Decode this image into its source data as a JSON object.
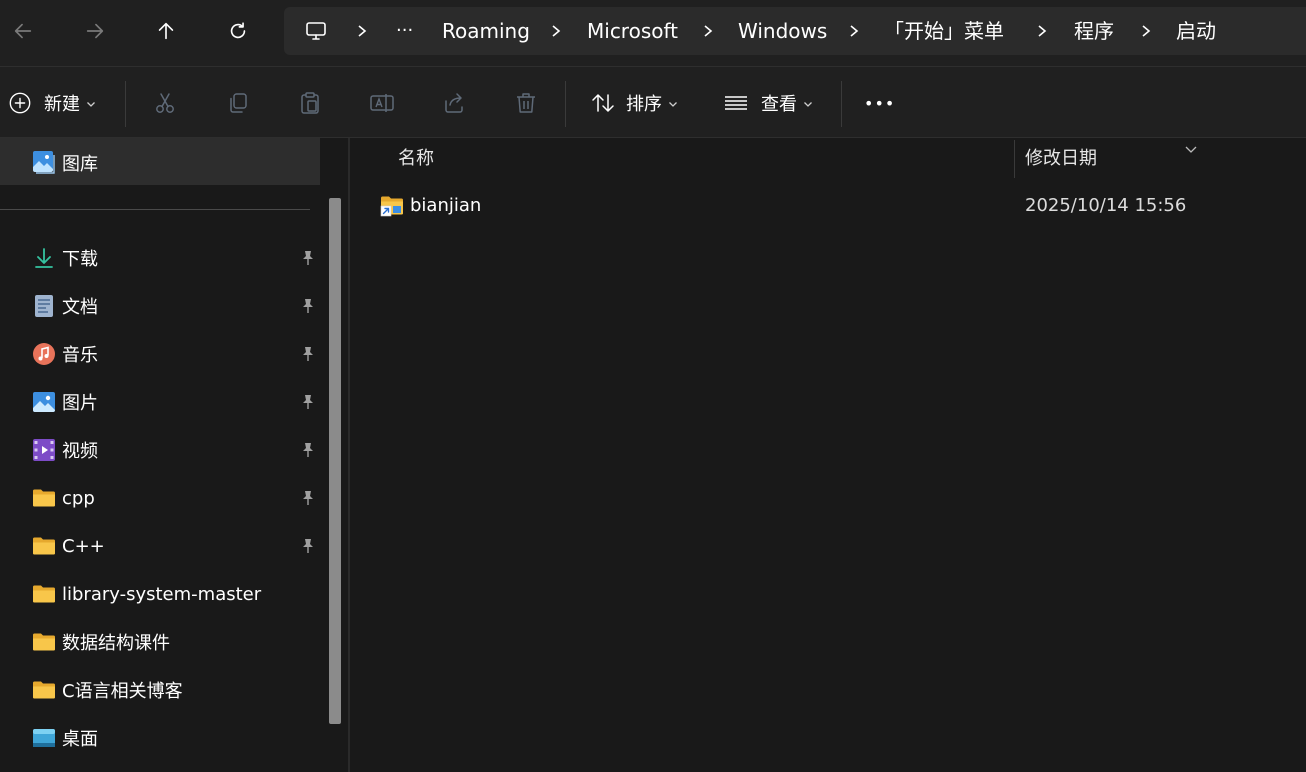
{
  "breadcrumb": {
    "ellipsis": "···",
    "items": [
      "Roaming",
      "Microsoft",
      "Windows",
      "「开始」菜单",
      "程序",
      "启动"
    ]
  },
  "toolbar": {
    "new_label": "新建",
    "sort_label": "排序",
    "view_label": "查看",
    "more_label": "•••"
  },
  "sidebar": {
    "gallery": "图库",
    "items": [
      {
        "label": "下载",
        "icon": "download-icon",
        "pinned": true
      },
      {
        "label": "文档",
        "icon": "document-icon",
        "pinned": true
      },
      {
        "label": "音乐",
        "icon": "music-icon",
        "pinned": true
      },
      {
        "label": "图片",
        "icon": "picture-icon",
        "pinned": true
      },
      {
        "label": "视频",
        "icon": "video-icon",
        "pinned": true
      },
      {
        "label": "cpp",
        "icon": "folder-icon",
        "pinned": true
      },
      {
        "label": "C++",
        "icon": "folder-icon",
        "pinned": true
      },
      {
        "label": "library-system-master",
        "icon": "folder-icon",
        "pinned": false
      },
      {
        "label": "数据结构课件",
        "icon": "folder-icon",
        "pinned": false
      },
      {
        "label": "C语言相关博客",
        "icon": "folder-icon",
        "pinned": false
      },
      {
        "label": "桌面",
        "icon": "desktop-icon",
        "pinned": false
      }
    ]
  },
  "content": {
    "columns": {
      "name": "名称",
      "modified": "修改日期"
    },
    "files": [
      {
        "name": "bianjian",
        "modified": "2025/10/14 15:56",
        "icon": "folder-shortcut-icon"
      }
    ]
  },
  "colors": {
    "window_bg": "#191919",
    "bar_bg": "#202020",
    "address_bg": "#2b2b2b",
    "selected_bg": "#2d2d2d",
    "folder_yellow": "#f8c64a",
    "accent_blue": "#3a8ee6"
  }
}
